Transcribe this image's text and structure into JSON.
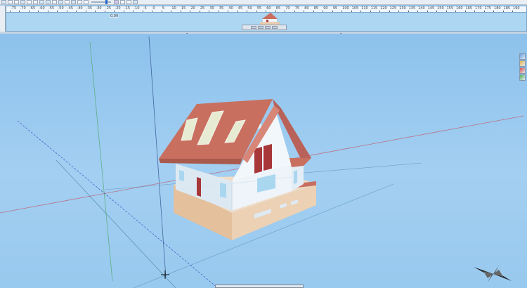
{
  "plan": {
    "level_label": "0,00",
    "ruler_ticks": [
      "-75",
      "-70",
      "-65",
      "-60",
      "-55",
      "-50",
      "-45",
      "-40",
      "-35",
      "-30",
      "-25",
      "-20",
      "-15",
      "-10",
      "-5",
      "0",
      "5",
      "10",
      "15",
      "20",
      "25",
      "30",
      "35",
      "40",
      "45",
      "50",
      "55",
      "60",
      "65",
      "70",
      "75",
      "80",
      "85",
      "90",
      "95",
      "100",
      "105",
      "110",
      "115",
      "120",
      "125",
      "130",
      "135",
      "140",
      "145",
      "150",
      "155",
      "160",
      "165",
      "170",
      "175",
      "180",
      "185",
      "190"
    ]
  },
  "colors": {
    "sky_top": "#8dc2ec",
    "roof": "#c86f5f",
    "walls": "#e8f1f7",
    "basement": "#e9c9a8",
    "window_shutters": "#a8373a",
    "window_glass": "#a9d7ef",
    "axis_red": "#c25a6a",
    "axis_green": "#4fa86a",
    "axis_blue": "#2f4fbf"
  },
  "icons": [
    "compass-rose-icon",
    "origin-cross-icon",
    "toolbar-icons",
    "view-control-icons"
  ]
}
